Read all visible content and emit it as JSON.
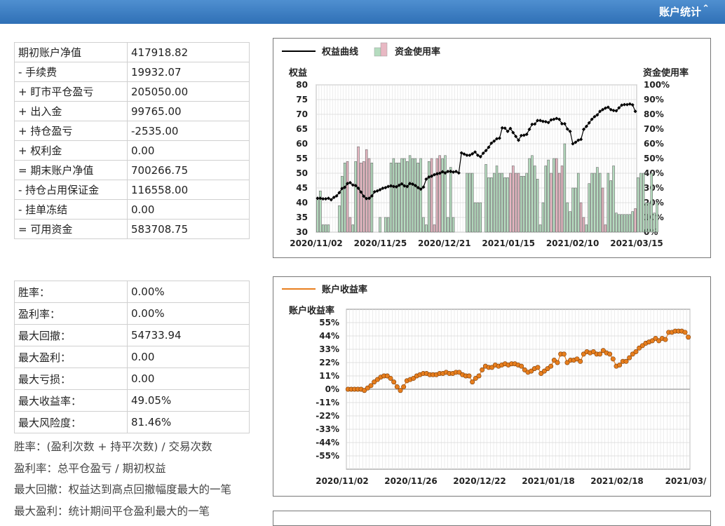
{
  "header": {
    "title": "账户统计",
    "collapse_icon": "double-chevron-up-icon"
  },
  "account_table": [
    {
      "label": "期初账户净值",
      "value": "417918.82"
    },
    {
      "label": "- 手续费",
      "value": "19932.07"
    },
    {
      "label": "+ 盯市平仓盈亏",
      "value": "205050.00"
    },
    {
      "label": "+ 出入金",
      "value": "99765.00"
    },
    {
      "label": "+ 持仓盈亏",
      "value": "-2535.00"
    },
    {
      "label": "+ 权利金",
      "value": "0.00"
    },
    {
      "label": "= 期末账户净值",
      "value": "700266.75"
    },
    {
      "label": "- 持仓占用保证金",
      "value": "116558.00"
    },
    {
      "label": "- 挂单冻结",
      "value": "0.00"
    },
    {
      "label": "= 可用资金",
      "value": "583708.75"
    }
  ],
  "performance_table": [
    {
      "label": "胜率：",
      "value": "0.00%"
    },
    {
      "label": "盈利率：",
      "value": "0.00%"
    },
    {
      "label": "最大回撤：",
      "value": "54733.94"
    },
    {
      "label": "最大盈利：",
      "value": "0.00"
    },
    {
      "label": "最大亏损：",
      "value": "0.00"
    },
    {
      "label": "最大收益率：",
      "value": "49.05%"
    },
    {
      "label": "最大风险度：",
      "value": "81.46%"
    }
  ],
  "notes": [
    "胜率：(盈利次数 + 持平次数) / 交易次数",
    "盈利率：总平仓盈亏 / 期初权益",
    "最大回撤：权益达到高点回撤幅度最大的一笔",
    "最大盈利：统计期间平仓盈利最大的一笔"
  ],
  "chart_data": [
    {
      "type": "line",
      "legend": [
        "权益曲线",
        "资金使用率"
      ],
      "ylabel": "权益",
      "y2label": "资金使用率",
      "ylim": [
        30,
        80
      ],
      "yticks": [
        "80",
        "75",
        "70",
        "65",
        "60",
        "55",
        "50",
        "45",
        "40",
        "35",
        "30"
      ],
      "y2lim": [
        0,
        100
      ],
      "y2ticks": [
        "100%",
        "90%",
        "80%",
        "70%",
        "60%",
        "50%",
        "40%",
        "30%",
        "20%",
        "10%",
        "0%"
      ],
      "xticks": [
        "2020/11/02",
        "2020/11/25",
        "2020/12/21",
        "2021/01/15",
        "2021/02/10",
        "2021/03/15"
      ],
      "colors": {
        "equity": "#000000",
        "usage_green": "#b5dcbf",
        "usage_pink": "#e8b8c3"
      },
      "series": [
        {
          "name": "权益曲线",
          "values": [
            41.5,
            41.5,
            41.3,
            41.3,
            41.5,
            41.0,
            41.8,
            42.3,
            43.4,
            44.8,
            45.2,
            46.5,
            46.8,
            46.0,
            45.8,
            44.9,
            43.6,
            42.2,
            41.4,
            41.5,
            42.3,
            43.7,
            44.0,
            44.4,
            44.9,
            45.1,
            45.5,
            45.7,
            45.5,
            45.4,
            45.9,
            46.4,
            45.7,
            45.5,
            46.5,
            46.3,
            45.8,
            45.1,
            44.6,
            45.3,
            48.0,
            48.7,
            49.0,
            49.5,
            49.8,
            50.0,
            50.5,
            50.1,
            50.6,
            50.6,
            50.4,
            50.6,
            50.1,
            56.9,
            56.5,
            56.1,
            56.1,
            56.6,
            57.2,
            56.1,
            55.6,
            56.8,
            57.7,
            58.8,
            60.2,
            60.9,
            61.7,
            61.9,
            65.4,
            65.3,
            64.2,
            65.2,
            63.8,
            62.5,
            61.2,
            62.8,
            62.9,
            63.2,
            64.9,
            66.6,
            66.7,
            67.9,
            67.9,
            67.6,
            67.5,
            67.2,
            68.1,
            68.3,
            68.6,
            68.3,
            66.8,
            66.8,
            65.0,
            64.2,
            60.0,
            60.5,
            61.2,
            61.5,
            64.9,
            65.9,
            67.1,
            68.3,
            69.2,
            69.8,
            71.0,
            71.6,
            72.1,
            72.4,
            71.6,
            71.3,
            71.2,
            72.2,
            73.1,
            73.3,
            73.3,
            73.5,
            73.2,
            71.0
          ]
        },
        {
          "name": "资金使用率",
          "values": [
            22,
            28,
            5,
            5,
            5,
            0,
            0,
            0,
            18,
            38,
            47,
            48,
            10,
            5,
            48,
            58,
            47,
            48,
            56,
            50,
            47,
            0,
            0,
            10,
            0,
            10,
            10,
            47,
            50,
            47,
            47,
            50,
            50,
            48,
            52,
            50,
            50,
            47,
            50,
            10,
            5,
            48,
            50,
            5,
            50,
            52,
            50,
            52,
            10,
            44,
            10,
            0,
            0,
            0,
            0,
            40,
            40,
            40,
            20,
            20,
            20,
            0,
            46,
            37,
            37,
            40,
            45,
            40,
            40,
            37,
            37,
            40,
            45,
            40,
            40,
            38,
            38,
            40,
            50,
            52,
            45,
            36,
            5,
            20,
            45,
            49,
            40,
            50,
            50,
            40,
            45,
            60,
            20,
            14,
            30,
            30,
            40,
            20,
            10,
            5,
            33,
            40,
            40,
            44,
            40,
            30,
            5,
            40,
            35,
            45,
            13,
            12,
            12,
            12,
            12,
            12,
            14,
            16,
            37,
            40,
            40,
            20,
            20,
            40,
            13,
            20
          ]
        },
        {
          "name": "资金使用率-pink",
          "values": [
            0,
            0,
            0,
            0,
            0,
            0,
            0,
            0,
            0,
            0,
            0,
            0,
            0,
            0,
            0,
            0,
            0,
            0,
            0,
            0,
            0,
            0,
            0,
            0,
            0,
            0,
            0,
            0,
            0,
            0,
            0,
            0,
            0,
            0,
            0,
            0,
            0,
            0,
            0,
            0,
            0,
            0,
            0,
            0,
            0,
            0,
            0,
            0,
            0,
            0,
            0,
            0,
            0,
            0,
            0,
            0,
            0,
            0,
            0,
            0,
            0,
            0,
            0,
            0,
            0,
            0,
            0,
            0,
            0,
            0,
            0,
            0,
            0,
            0,
            0,
            0,
            0,
            0,
            0,
            0,
            0,
            0,
            0,
            0,
            0,
            0,
            0,
            0,
            0,
            0,
            0,
            0,
            0,
            0,
            0,
            0,
            0,
            0,
            0,
            0,
            0,
            0,
            0,
            0,
            0,
            0,
            0,
            0,
            0,
            0,
            0,
            0,
            0,
            0,
            0,
            0,
            0,
            0,
            0,
            0
          ]
        }
      ]
    },
    {
      "type": "line",
      "legend": [
        "账户收益率"
      ],
      "ylabel": "账户收益率",
      "ylim": [
        -66,
        66
      ],
      "yticks": [
        "55%",
        "44%",
        "33%",
        "22%",
        "11%",
        "0%",
        "-11%",
        "-22%",
        "-33%",
        "-44%",
        "-55%"
      ],
      "xticks": [
        "2020/11/02",
        "2020/11/26",
        "2020/12/22",
        "2021/01/18",
        "2021/02/18",
        "2021/03/"
      ],
      "colors": {
        "line": "#e87f1e",
        "marker": "#e87f1e"
      },
      "series": [
        {
          "name": "账户收益率",
          "values": [
            0,
            0,
            0,
            0,
            0,
            -1,
            1,
            3,
            6,
            8,
            10,
            11,
            11,
            9,
            6,
            2,
            -1,
            2,
            7,
            8,
            9,
            11,
            12,
            13,
            13,
            12,
            12,
            12,
            13,
            13,
            14,
            13,
            13,
            14,
            14,
            12,
            11,
            11,
            6,
            9,
            11,
            16,
            19,
            18,
            18,
            20,
            19,
            20,
            21,
            20,
            21,
            21,
            20,
            19,
            16,
            14,
            15,
            17,
            18,
            13,
            15,
            17,
            19,
            24,
            22,
            29,
            29,
            22,
            24,
            24,
            25,
            23,
            29,
            31,
            30,
            31,
            29,
            29,
            32,
            30,
            29,
            25,
            19,
            20,
            23,
            23,
            26,
            29,
            31,
            34,
            36,
            38,
            39,
            40,
            42,
            40,
            42,
            41,
            47,
            47,
            48,
            48,
            48,
            47,
            43
          ]
        }
      ]
    }
  ]
}
